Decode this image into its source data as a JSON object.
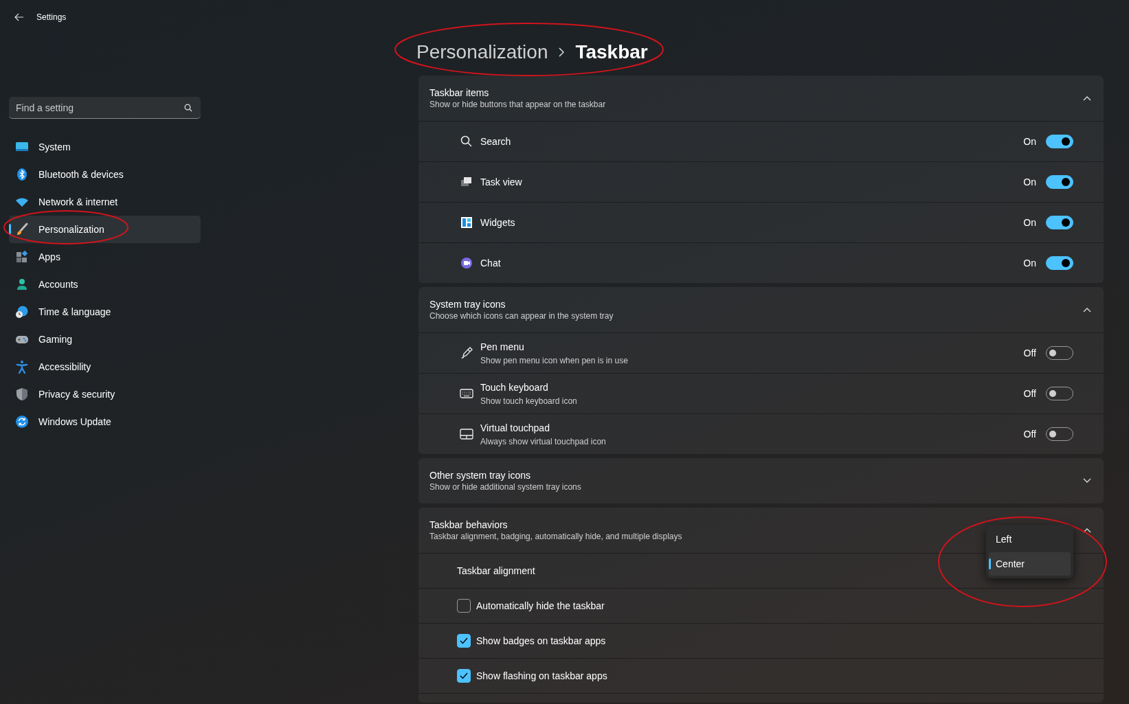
{
  "window": {
    "title": "Settings"
  },
  "search": {
    "placeholder": "Find a setting"
  },
  "sidebar": {
    "items": [
      {
        "label": "System",
        "selected": false
      },
      {
        "label": "Bluetooth & devices",
        "selected": false
      },
      {
        "label": "Network & internet",
        "selected": false
      },
      {
        "label": "Personalization",
        "selected": true
      },
      {
        "label": "Apps",
        "selected": false
      },
      {
        "label": "Accounts",
        "selected": false
      },
      {
        "label": "Time & language",
        "selected": false
      },
      {
        "label": "Gaming",
        "selected": false
      },
      {
        "label": "Accessibility",
        "selected": false
      },
      {
        "label": "Privacy & security",
        "selected": false
      },
      {
        "label": "Windows Update",
        "selected": false
      }
    ]
  },
  "breadcrumb": [
    "Personalization",
    "Taskbar"
  ],
  "sections": [
    {
      "title": "Taskbar items",
      "subtitle": "Show or hide buttons that appear on the taskbar",
      "expanded": true,
      "rows": [
        {
          "kind": "toggle",
          "label": "Search",
          "on": true,
          "state_text": "On"
        },
        {
          "kind": "toggle",
          "label": "Task view",
          "on": true,
          "state_text": "On"
        },
        {
          "kind": "toggle",
          "label": "Widgets",
          "on": true,
          "state_text": "On"
        },
        {
          "kind": "toggle",
          "label": "Chat",
          "on": true,
          "state_text": "On"
        }
      ]
    },
    {
      "title": "System tray icons",
      "subtitle": "Choose which icons can appear in the system tray",
      "expanded": true,
      "rows": [
        {
          "kind": "toggle",
          "label": "Pen menu",
          "description": "Show pen menu icon when pen is in use",
          "on": false,
          "state_text": "Off"
        },
        {
          "kind": "toggle",
          "label": "Touch keyboard",
          "description": "Show touch keyboard icon",
          "on": false,
          "state_text": "Off"
        },
        {
          "kind": "toggle",
          "label": "Virtual touchpad",
          "description": "Always show virtual touchpad icon",
          "on": false,
          "state_text": "Off"
        }
      ]
    },
    {
      "title": "Other system tray icons",
      "subtitle": "Show or hide additional system tray icons",
      "expanded": false
    },
    {
      "title": "Taskbar behaviors",
      "subtitle": "Taskbar alignment, badging, automatically hide, and multiple displays",
      "expanded": true,
      "rows": [
        {
          "kind": "dropdown",
          "label": "Taskbar alignment",
          "options": [
            {
              "label": "Left",
              "selected": false
            },
            {
              "label": "Center",
              "selected": true
            }
          ]
        },
        {
          "kind": "checkbox",
          "label": "Automatically hide the taskbar",
          "checked": false
        },
        {
          "kind": "checkbox",
          "label": "Show badges on taskbar apps",
          "checked": true
        },
        {
          "kind": "checkbox",
          "label": "Show flashing on taskbar apps",
          "checked": true
        }
      ]
    }
  ]
}
